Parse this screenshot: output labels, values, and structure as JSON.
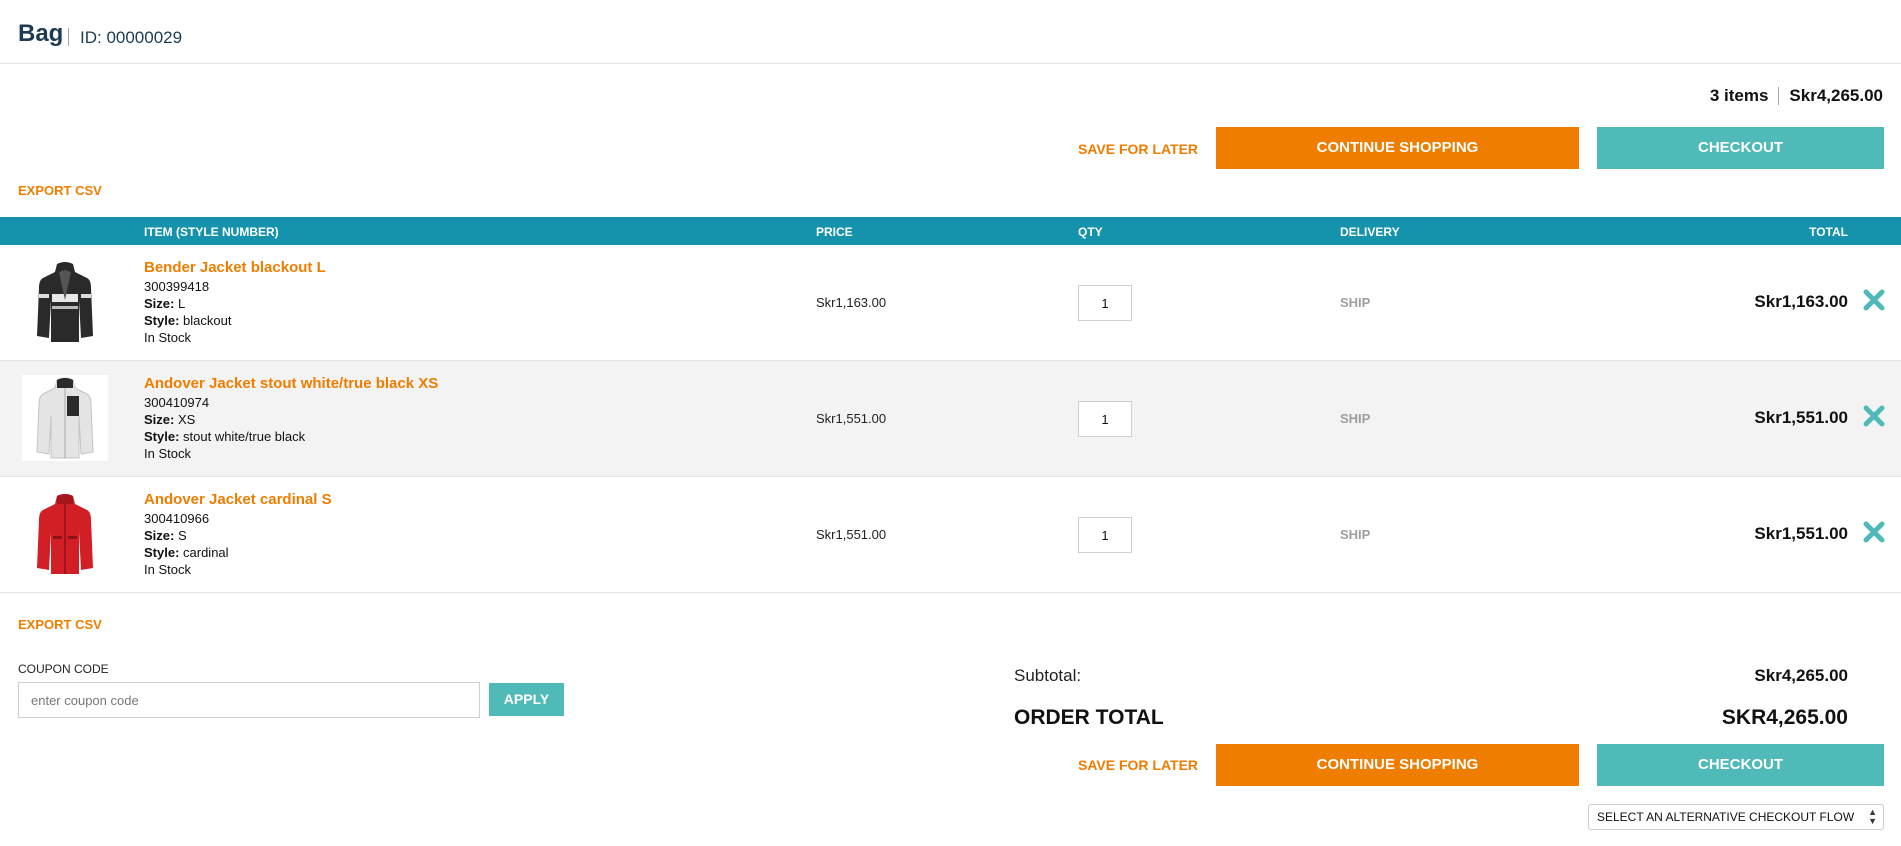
{
  "header": {
    "title": "Bag",
    "id_label": "ID: 00000029"
  },
  "summary": {
    "items": "3 items",
    "amount": "Skr4,265.00"
  },
  "actions": {
    "save_for_later": "SAVE FOR LATER",
    "continue_shopping": "CONTINUE SHOPPING",
    "checkout": "CHECKOUT",
    "export_csv": "EXPORT CSV"
  },
  "table": {
    "headers": [
      "ITEM (STYLE NUMBER)",
      "PRICE",
      "QTY",
      "DELIVERY",
      "TOTAL"
    ],
    "rows": [
      {
        "name": "Bender Jacket blackout L",
        "style_number": "300399418",
        "size_label": "Size:",
        "size": " L",
        "style_label": "Style:",
        "style": " blackout",
        "stock": "In Stock",
        "price": "Skr1,163.00",
        "qty": "1",
        "delivery": "SHIP",
        "total": "Skr1,163.00",
        "image_icon": "jacket-black-icon"
      },
      {
        "name": "Andover Jacket stout white/true black XS",
        "style_number": "300410974",
        "size_label": "Size:",
        "size": " XS",
        "style_label": "Style:",
        "style": " stout white/true black",
        "stock": "In Stock",
        "price": "Skr1,551.00",
        "qty": "1",
        "delivery": "SHIP",
        "total": "Skr1,551.00",
        "image_icon": "jacket-white-icon"
      },
      {
        "name": "Andover Jacket cardinal S",
        "style_number": "300410966",
        "size_label": "Size:",
        "size": " S",
        "style_label": "Style:",
        "style": " cardinal",
        "stock": "In Stock",
        "price": "Skr1,551.00",
        "qty": "1",
        "delivery": "SHIP",
        "total": "Skr1,551.00",
        "image_icon": "jacket-red-icon"
      }
    ]
  },
  "coupon": {
    "label": "COUPON CODE",
    "placeholder": "enter coupon code",
    "apply": "APPLY"
  },
  "totals": {
    "subtotal_label": "Subtotal:",
    "subtotal": "Skr4,265.00",
    "order_total_label": "ORDER TOTAL",
    "order_total": "SKR4,265.00"
  },
  "alt_checkout": {
    "selected": "SELECT AN ALTERNATIVE CHECKOUT FLOW"
  },
  "colors": {
    "accent_orange": "#ee7d00",
    "teal": "#4fbab7",
    "header_bar": "#1592ac",
    "title_navy": "#1c3a52"
  }
}
